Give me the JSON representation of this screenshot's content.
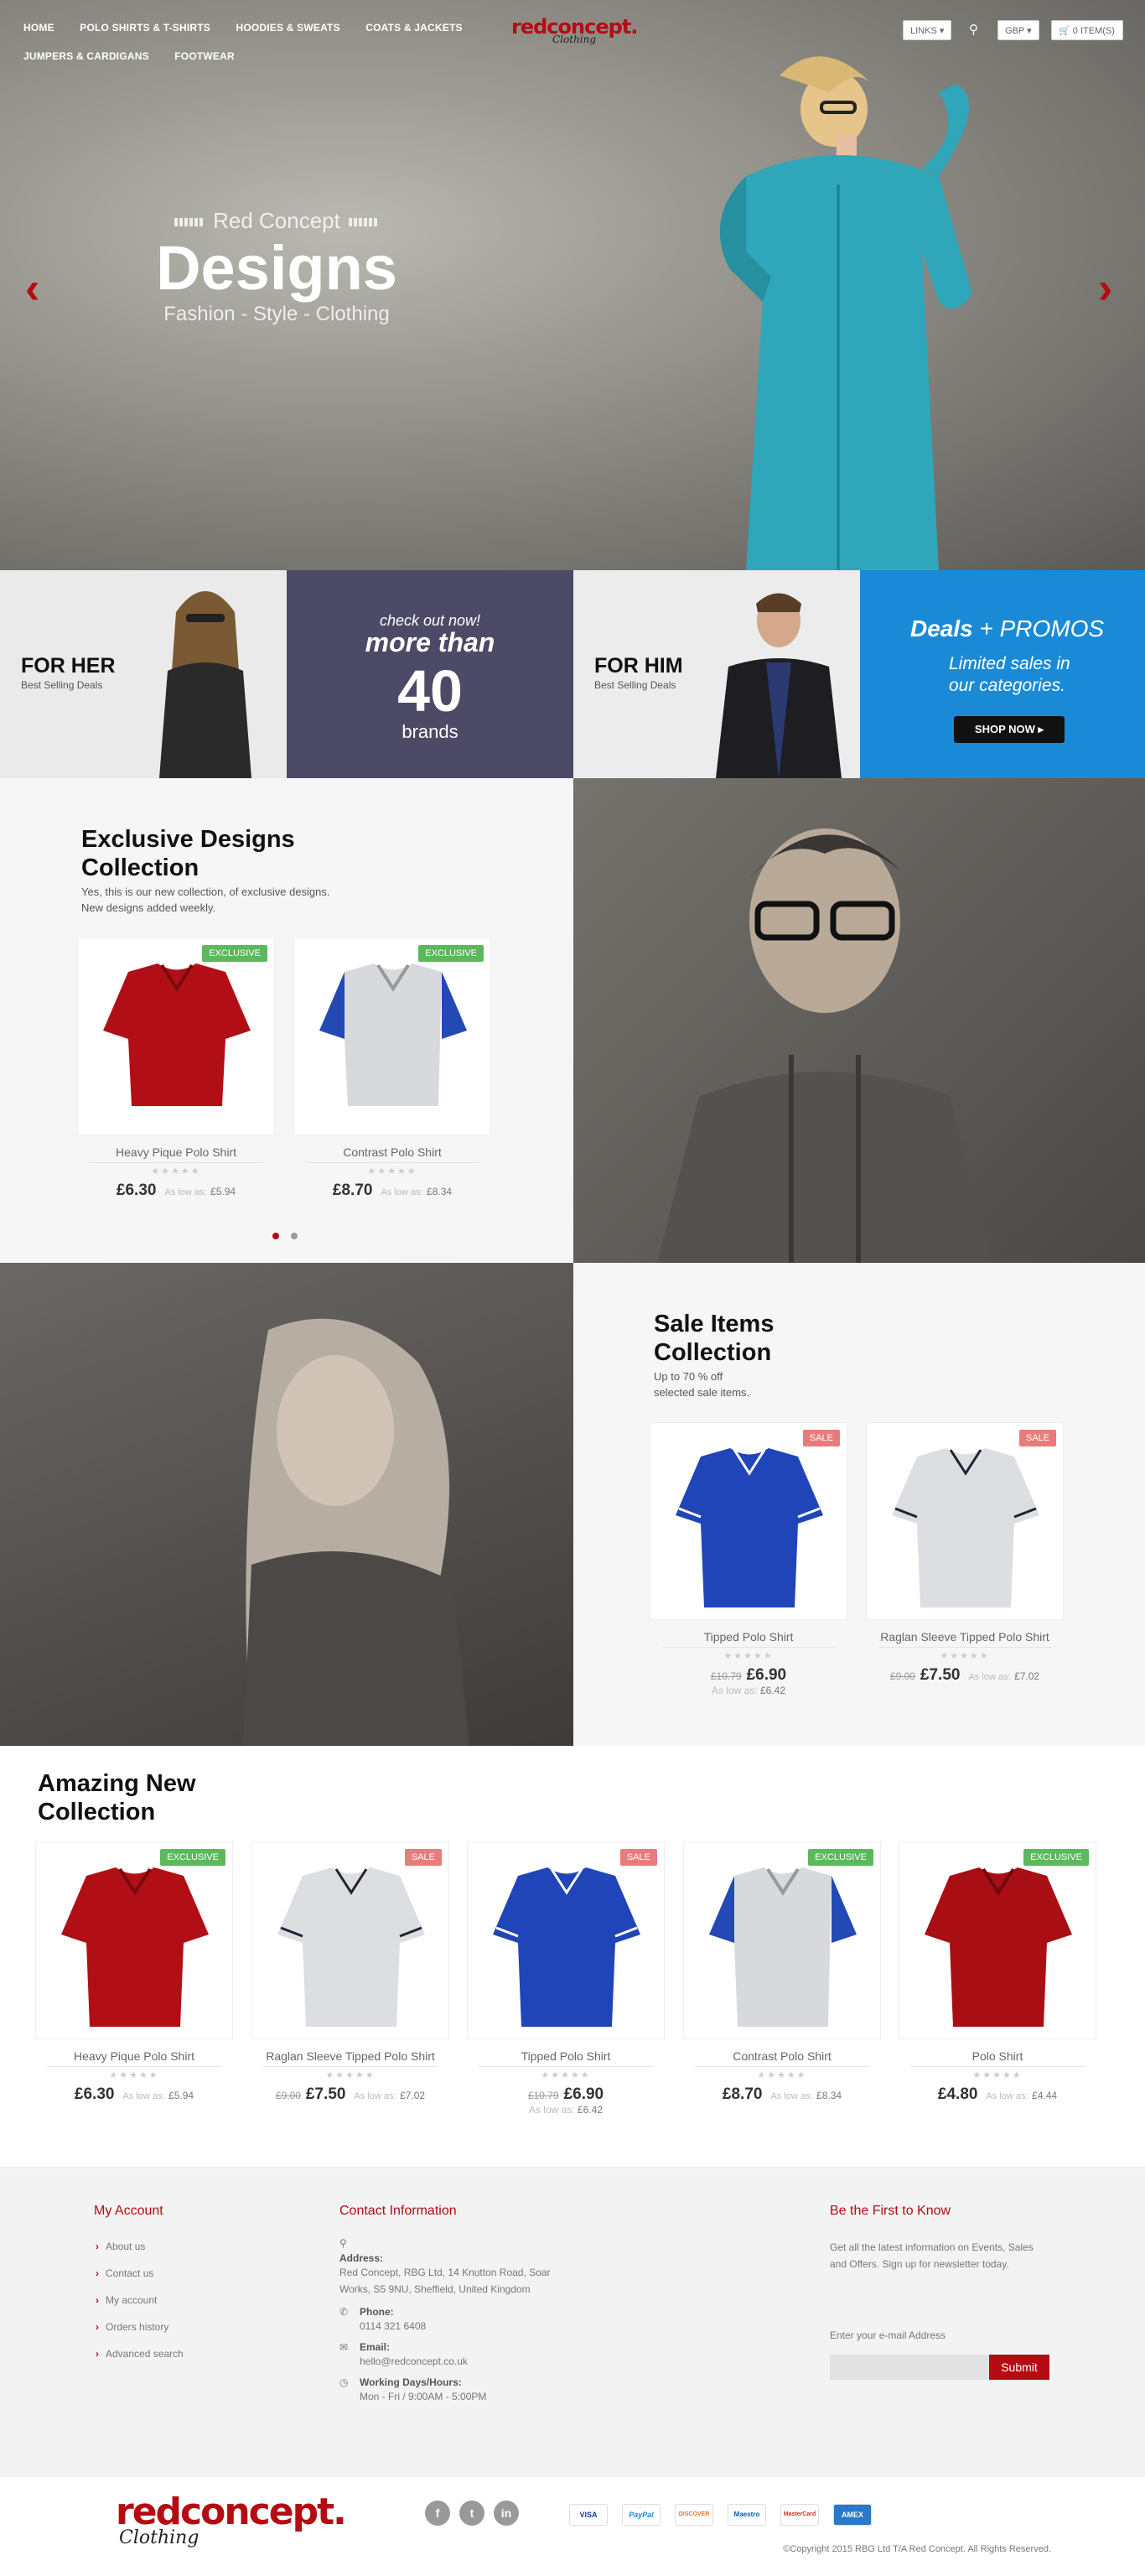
{
  "nav": {
    "items": [
      "HOME",
      "POLO SHIRTS & T-SHIRTS",
      "HOODIES & SWEATS",
      "COATS & JACKETS",
      "JUMPERS & CARDIGANS",
      "FOOTWEAR"
    ],
    "links_label": "LINKS",
    "currency": "GBP",
    "cart_label": "0 ITEM(S)"
  },
  "logo": {
    "main": "redconcept.",
    "script": "Clothing"
  },
  "hero": {
    "pre": "Red Concept",
    "title": "Designs",
    "subtitle": "Fashion - Style - Clothing"
  },
  "promos": {
    "her": {
      "title": "FOR HER",
      "sub": "Best Selling Deals"
    },
    "brands": {
      "line1": "check out now!",
      "line2": "more than",
      "number": "40",
      "line3": "brands"
    },
    "him": {
      "title": "FOR HIM",
      "sub": "Best Selling Deals"
    },
    "deals": {
      "title_a": "Deals",
      "title_b": "+ PROMOS",
      "desc1": "Limited sales in",
      "desc2": "our categories.",
      "button": "SHOP NOW"
    }
  },
  "exclusive": {
    "title1": "Exclusive Designs",
    "title2": "Collection",
    "desc1": "Yes, this is our new collection, of exclusive designs.",
    "desc2": "New designs added weekly.",
    "products": [
      {
        "badge": "EXCLUSIVE",
        "name": "Heavy Pique Polo Shirt",
        "price": "£6.30",
        "as_low": "As low as:",
        "low": "£5.94"
      },
      {
        "badge": "EXCLUSIVE",
        "name": "Contrast Polo Shirt",
        "price": "£8.70",
        "as_low": "As low as:",
        "low": "£8.34"
      }
    ]
  },
  "sale": {
    "title1": "Sale Items",
    "title2": "Collection",
    "desc1": "Up to 70 % off",
    "desc2": "selected sale items.",
    "products": [
      {
        "badge": "SALE",
        "name": "Tipped Polo Shirt",
        "old": "£10.79",
        "price": "£6.90",
        "as_low": "As low as:",
        "low": "£6.42"
      },
      {
        "badge": "SALE",
        "name": "Raglan Sleeve Tipped Polo Shirt",
        "old": "£9.00",
        "price": "£7.50",
        "as_low": "As low as:",
        "low": "£7.02"
      }
    ]
  },
  "amazing": {
    "title1": "Amazing New",
    "title2": "Collection",
    "products": [
      {
        "badge": "EXCLUSIVE",
        "name": "Heavy Pique Polo Shirt",
        "old": "",
        "price": "£6.30",
        "as_low": "As low as:",
        "low": "£5.94"
      },
      {
        "badge": "SALE",
        "name": "Raglan Sleeve Tipped Polo Shirt",
        "old": "£9.00",
        "price": "£7.50",
        "as_low": "As low as:",
        "low": "£7.02"
      },
      {
        "badge": "SALE",
        "name": "Tipped Polo Shirt",
        "old": "£10.79",
        "price": "£6.90",
        "as_low": "As low as:",
        "low": "£6.42"
      },
      {
        "badge": "EXCLUSIVE",
        "name": "Contrast Polo Shirt",
        "old": "",
        "price": "£8.70",
        "as_low": "As low as:",
        "low": "£8.34"
      },
      {
        "badge": "EXCLUSIVE",
        "name": "Polo Shirt",
        "old": "",
        "price": "£4.80",
        "as_low": "As low as:",
        "low": "£4.44"
      }
    ]
  },
  "footer": {
    "account_title": "My Account",
    "account_links": [
      "About us",
      "Contact us",
      "My account",
      "Orders history",
      "Advanced search"
    ],
    "contact_title": "Contact Information",
    "address_label": "Address:",
    "address": "Red Concept, RBG Ltd, 14 Knutton Road, Soar Works, S5 9NU, Sheffield, United Kingdom",
    "phone_label": "Phone:",
    "phone": "0114 321 6408",
    "email_label": "Email:",
    "email": "hello@redconcept.co.uk",
    "hours_label": "Working Days/Hours:",
    "hours": "Mon - Fri / 9:00AM - 5:00PM",
    "news_title": "Be the First to Know",
    "news_desc": "Get all the latest information on Events, Sales and Offers. Sign up for newsletter today.",
    "news_label": "Enter your e-mail Address",
    "submit": "Submit",
    "payments": [
      "VISA",
      "PayPal",
      "DISCOVER",
      "Maestro",
      "MasterCard",
      "AMEX"
    ],
    "copyright": "©Copyright 2015 RBG Ltd T/A Red Concept. All Rights Reserved."
  },
  "colors": {
    "brand_red": "#b40c12",
    "exclusive_green": "#5cb85c",
    "sale_pink": "#e77c7c",
    "promo_blue": "#1b8ad6",
    "promo_purple": "#4c4a66"
  }
}
